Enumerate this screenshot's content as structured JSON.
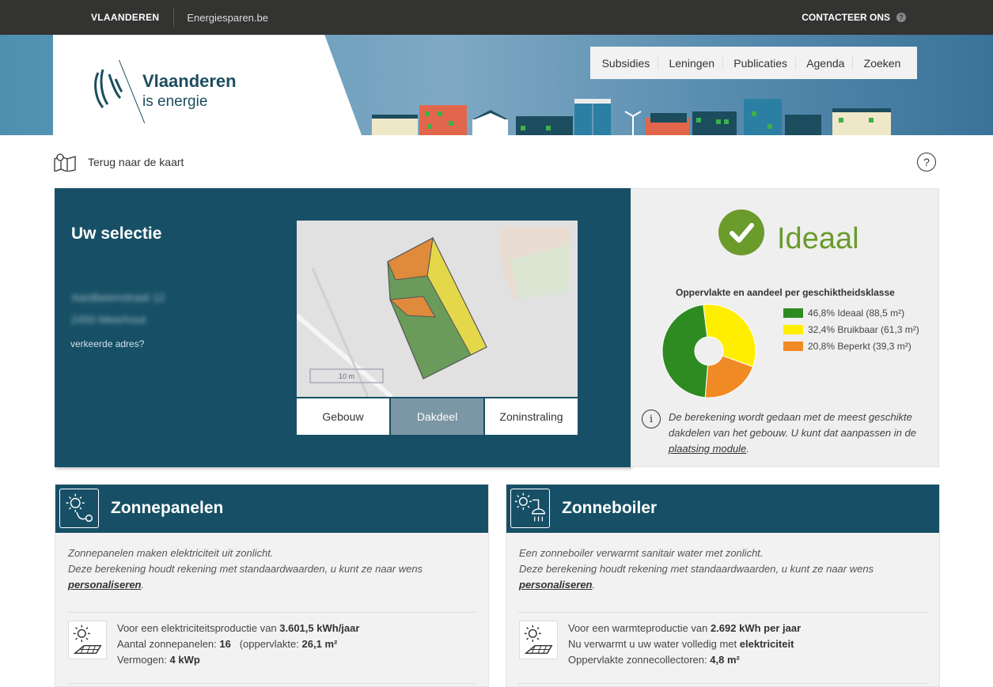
{
  "topbar": {
    "brand": "VLAANDEREN",
    "site": "Energiesparen.be",
    "contact": "CONTACTEER ONS",
    "contact_help": "?"
  },
  "logo": {
    "line1": "Vlaanderen",
    "line2": "is energie"
  },
  "mainnav": [
    "Subsidies",
    "Leningen",
    "Publicaties",
    "Agenda",
    "Zoeken"
  ],
  "back": {
    "label": "Terug naar de kaart",
    "help": "?"
  },
  "selection": {
    "title": "Uw selectie",
    "address_line1": "Aardbeienstraat 12",
    "address_line2": "2450 Meerhout",
    "wrong_address": "verkeerde adres?",
    "scale_label": "10 m",
    "tabs": [
      "Gebouw",
      "Dakdeel",
      "Zoninstraling"
    ],
    "active_tab": "Dakdeel"
  },
  "result": {
    "status": "Ideaal",
    "chart_title": "Oppervlakte en aandeel per geschiktheidsklasse",
    "info_text": "De berekening wordt gedaan met de meest geschikte dakdelen van het gebouw. U kunt dat aanpassen in de",
    "info_link": "plaatsing module",
    "info_end": "."
  },
  "chart_data": {
    "type": "pie",
    "title": "Oppervlakte en aandeel per geschiktheidsklasse",
    "donut": true,
    "categories": [
      "Ideaal",
      "Bruikbaar",
      "Beperkt"
    ],
    "values": [
      46.8,
      32.4,
      20.8
    ],
    "areas_m2": [
      88.5,
      61.3,
      39.3
    ],
    "legend_labels": [
      "46,8% Ideaal (88,5 m²)",
      "32,4% Bruikbaar (61,3 m²)",
      "20,8% Beperkt (39,3 m²)"
    ],
    "colors": [
      "#2e8b22",
      "#ffee00",
      "#f08a24"
    ],
    "legend_position": "right"
  },
  "cards": [
    {
      "title": "Zonnepanelen",
      "intro1": "Zonnepanelen maken elektriciteit uit zonlicht.",
      "intro2": "Deze berekening houdt rekening met standaardwaarden, u kunt ze naar wens",
      "link": "personaliseren",
      "link_end": ".",
      "line1_pre": "Voor een elektriciteitsproductie van",
      "line1_val": "3.601,5",
      "line1_unit": "kWh/jaar",
      "line2_pre": "Aantal zonnepanelen:",
      "line2_val": "16",
      "line2_mid": "(oppervlakte:",
      "line2_val2": "26,1",
      "line2_unit": "m²",
      "line3_pre": "Vermogen:",
      "line3_val": "4",
      "line3_unit": "kWp"
    },
    {
      "title": "Zonneboiler",
      "intro1": "Een zonneboiler verwarmt sanitair water met zonlicht.",
      "intro2": "Deze berekening houdt rekening met standaardwaarden, u kunt ze naar wens",
      "link": "personaliseren",
      "link_end": ".",
      "line1_pre": "Voor een warmteproductie van",
      "line1_val": "2.692",
      "line1_unit": "kWh per jaar",
      "line2_pre": "Nu verwarmt u uw water volledig met",
      "line2_val": "elektriciteit",
      "line3_pre": "Oppervlakte zonnecollectoren:",
      "line3_val": "4,8",
      "line3_unit": "m²"
    }
  ],
  "colors": {
    "topbar": "#333332",
    "primary": "#175066",
    "ideal_green": "#6a9b2b",
    "panel_bg": "#efefef"
  }
}
